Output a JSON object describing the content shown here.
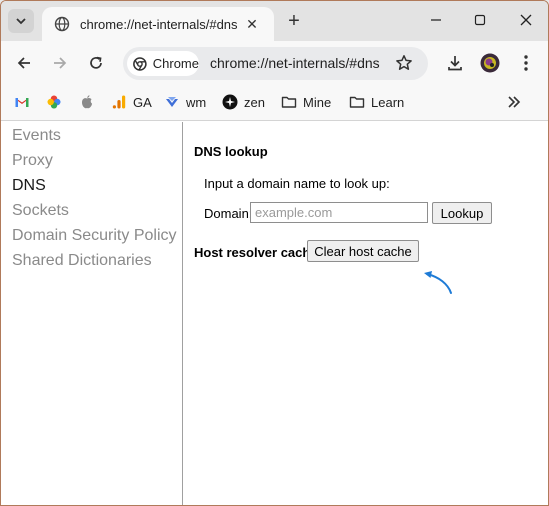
{
  "tab": {
    "title": "chrome://net-internals/#dns"
  },
  "toolbar": {
    "chip_label": "Chrome",
    "url": "chrome://net-internals/#dns"
  },
  "bookmarks": [
    {
      "icon": "gmail-icon",
      "label": ""
    },
    {
      "icon": "photos-icon",
      "label": ""
    },
    {
      "icon": "apple-icon",
      "label": ""
    },
    {
      "icon": "analytics-icon",
      "label": "GA"
    },
    {
      "icon": "wm-icon",
      "label": "wm"
    },
    {
      "icon": "zen-icon",
      "label": "zen"
    },
    {
      "icon": "folder-icon",
      "label": "Mine"
    },
    {
      "icon": "folder-icon",
      "label": "Learn"
    }
  ],
  "sidebar": {
    "items": [
      {
        "label": "Events"
      },
      {
        "label": "Proxy"
      },
      {
        "label": "DNS"
      },
      {
        "label": "Sockets"
      },
      {
        "label": "Domain Security Policy"
      },
      {
        "label": "Shared Dictionaries"
      }
    ],
    "active": "DNS"
  },
  "dns": {
    "heading": "DNS lookup",
    "prompt": "Input a domain name to look up:",
    "domain_label": "Domain:",
    "domain_placeholder": "example.com",
    "domain_value": "",
    "lookup_button": "Lookup",
    "cache_heading": "Host resolver cache",
    "clear_button": "Clear host cache"
  },
  "colors": {
    "annotation_arrow": "#1e7bd6",
    "window_border": "#b07a5a"
  }
}
